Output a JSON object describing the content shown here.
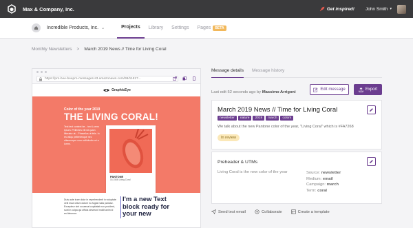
{
  "topbar": {
    "company": "Max & Company, Inc.",
    "inspired": "Get inspired!",
    "user": "John Smith"
  },
  "nav": {
    "project": "Incredible Products, Inc.",
    "tabs": [
      "Projects",
      "Library",
      "Settings",
      "Pages"
    ],
    "beta": "BETA"
  },
  "breadcrumb": {
    "parent": "Monthly Newsletters",
    "separator": ">",
    "current": "March 2019 News // Time for Living Coral"
  },
  "preview": {
    "url": "https://pro-bee-beepro-messages.s3.amazonaws.com/99/11617...",
    "brand": "GraphicEye",
    "hero_kicker": "Color of the year 2019",
    "hero_title": "THE LIVING CORAL!",
    "hero_body": "Test text content be... text Lorem Ipsum. Pellentes elit sit quam litteratur at... Phasellus ut felis. In est aliqu pellentesque nec ullamcorper cum sollicitudin mi a lorem.",
    "pantone": "PANTONE",
    "pantone_sub": "16-1546 Living Coral",
    "body_text": "Duis aute irure dolor in reprehenderit in voluptate velit esse cillum dolore eu fugiat nulla pariatur. Excepteur sint occaecat cupidatat non proident, sunt in culpa qui officia deserunt mollit anim id est laborum.",
    "new_text": "I'm a new Text block ready for your new"
  },
  "details": {
    "tabs": [
      "Message details",
      "Message history"
    ],
    "last_edit_prefix": "Last edit 52 seconds ago by",
    "last_edit_user": "Massimo Arrigoni",
    "edit_label": "Edit message",
    "export_label": "Export",
    "title": "March 2019 News // Time for Living Coral",
    "tags": [
      "newsletter",
      "nature",
      "2019",
      "march",
      "colors"
    ],
    "description": "We talk about the new Pantone color of the year, \"Living Coral\" which is #FA7268",
    "status": "In review",
    "preheader_title": "Preheader & UTMs",
    "preheader_text": "Living Coral is the new color of the year",
    "utm": {
      "source_label": "Source:",
      "source": "newsletter",
      "medium_label": "Medium:",
      "medium": "email",
      "campaign_label": "Campaign:",
      "campaign": "march",
      "term_label": "Term:",
      "term": "coral"
    }
  },
  "footer": [
    "Send test email",
    "Collaborate",
    "Create a template"
  ],
  "colors": {
    "accent": "#6b3d8f",
    "coral": "#f37a68",
    "topbar": "#3a3a3c",
    "beta": "#f2b85b"
  }
}
